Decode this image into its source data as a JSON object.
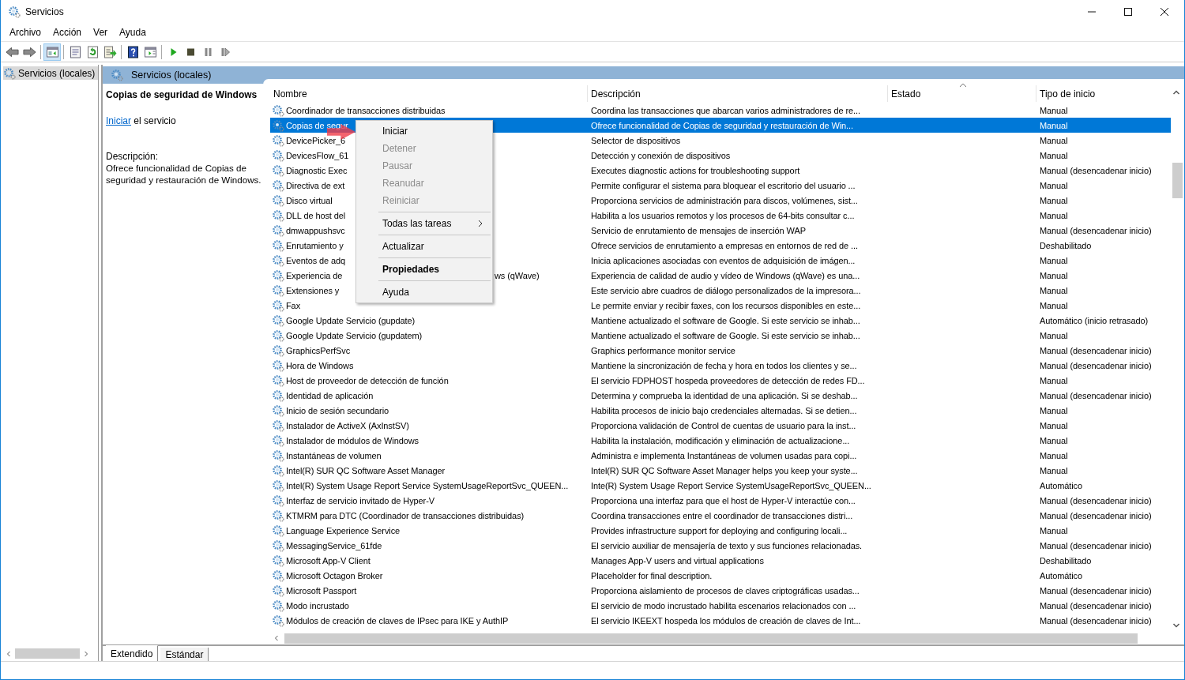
{
  "window": {
    "title": "Servicios"
  },
  "menu": [
    "Archivo",
    "Acción",
    "Ver",
    "Ayuda"
  ],
  "toolbar_groups": [
    {
      "buttons": [
        {
          "kind": "back",
          "pressed": false
        },
        {
          "kind": "forward",
          "pressed": false
        }
      ]
    },
    {
      "buttons": [
        {
          "kind": "console-tree",
          "pressed": true
        }
      ]
    },
    {
      "buttons": [
        {
          "kind": "properties",
          "pressed": false
        },
        {
          "kind": "refresh",
          "pressed": false
        },
        {
          "kind": "export",
          "pressed": false
        }
      ]
    },
    {
      "buttons": [
        {
          "kind": "help",
          "pressed": false
        },
        {
          "kind": "view",
          "pressed": false
        }
      ]
    },
    {
      "buttons": [
        {
          "kind": "play",
          "pressed": false
        },
        {
          "kind": "stop",
          "pressed": false
        },
        {
          "kind": "pause",
          "pressed": false
        },
        {
          "kind": "resume",
          "pressed": false
        }
      ]
    }
  ],
  "tree": [
    {
      "label": "Servicios (locales)",
      "selected": true
    }
  ],
  "pane_title": "Servicios (locales)",
  "detail": {
    "title": "Copias de seguridad de Windows",
    "action_link": "Iniciar",
    "action_rest": " el servicio",
    "description_label": "Descripción:",
    "description": "Ofrece funcionalidad de Copias de seguridad y restauración de Windows."
  },
  "table": {
    "columns": [
      {
        "label": "Nombre",
        "sorted": false
      },
      {
        "label": "Descripción",
        "sorted": false
      },
      {
        "label": "Estado",
        "sorted": true
      },
      {
        "label": "Tipo de inicio",
        "sorted": false
      }
    ],
    "rows": [
      {
        "name": "Coordinador de transacciones distribuidas",
        "description": "Coordina las transacciones que abarcan varios administradores de re...",
        "startup": "Manual",
        "selected": false
      },
      {
        "name": "Copias de segur",
        "description": "Ofrece funcionalidad de Copias de seguridad y restauración de Win...",
        "startup": "Manual",
        "selected": true
      },
      {
        "name": "DevicePicker_6",
        "description": "Selector de dispositivos",
        "startup": "Manual",
        "selected": false
      },
      {
        "name": "DevicesFlow_61",
        "description": "Detección y conexión de dispositivos",
        "startup": "Manual",
        "selected": false
      },
      {
        "name": "Diagnostic Exec",
        "description": "Executes diagnostic actions for troubleshooting support",
        "startup": "Manual (desencadenar inicio)",
        "selected": false
      },
      {
        "name": "Directiva de ext",
        "description": "Permite configurar el sistema para bloquear el escritorio del usuario ...",
        "startup": "Manual",
        "selected": false
      },
      {
        "name": "Disco virtual",
        "description": "Proporciona servicios de administración para discos, volúmenes, sist...",
        "startup": "Manual",
        "selected": false
      },
      {
        "name": "DLL de host del",
        "description": "Habilita a los usuarios remotos y los procesos de 64-bits consultar c...",
        "startup": "Manual",
        "selected": false
      },
      {
        "name": "dmwappushsvc",
        "description": "Servicio de enrutamiento de mensajes de inserción WAP",
        "startup": "Manual (desencadenar inicio)",
        "selected": false
      },
      {
        "name": "Enrutamiento y",
        "description": "Ofrece servicios de enrutamiento a empresas en entornos de red de ...",
        "startup": "Deshabilitado",
        "selected": false
      },
      {
        "name": "Eventos de adq",
        "description": "Inicia aplicaciones asociadas con eventos de adquisición de imágen...",
        "startup": "Manual",
        "selected": false
      },
      {
        "name": "Experiencia de",
        "name_tail": "ws (qWave)",
        "description": "Experiencia de calidad de audio y vídeo de Windows (qWave) es una...",
        "startup": "Manual",
        "selected": false
      },
      {
        "name": "Extensiones y",
        "description": "Este servicio abre cuadros de diálogo personalizados de la impresora...",
        "startup": "Manual",
        "selected": false
      },
      {
        "name": "Fax",
        "description": "Le permite enviar y recibir faxes, con los recursos disponibles en este...",
        "startup": "Manual",
        "selected": false
      },
      {
        "name": "Google Update Servicio (gupdate)",
        "description": "Mantiene actualizado el software de Google. Si este servicio se inhab...",
        "startup": "Automático (inicio retrasado)",
        "selected": false
      },
      {
        "name": "Google Update Servicio (gupdatem)",
        "description": "Mantiene actualizado el software de Google. Si este servicio se inhab...",
        "startup": "Manual",
        "selected": false
      },
      {
        "name": "GraphicsPerfSvc",
        "description": "Graphics performance monitor service",
        "startup": "Manual (desencadenar inicio)",
        "selected": false
      },
      {
        "name": "Hora de Windows",
        "description": "Mantiene la sincronización de fecha y hora en todos los clientes y se...",
        "startup": "Manual (desencadenar inicio)",
        "selected": false
      },
      {
        "name": "Host de proveedor de detección de función",
        "description": "El servicio FDPHOST hospeda proveedores de detección de redes FD...",
        "startup": "Manual",
        "selected": false
      },
      {
        "name": "Identidad de aplicación",
        "description": "Determina y comprueba la identidad de una aplicación. Si se deshab...",
        "startup": "Manual (desencadenar inicio)",
        "selected": false
      },
      {
        "name": "Inicio de sesión secundario",
        "description": "Habilita procesos de inicio bajo credenciales alternadas. Si se detien...",
        "startup": "Manual",
        "selected": false
      },
      {
        "name": "Instalador de ActiveX (AxInstSV)",
        "description": "Proporciona validación de Control de cuentas de usuario para la inst...",
        "startup": "Manual",
        "selected": false
      },
      {
        "name": "Instalador de módulos de Windows",
        "description": "Habilita la instalación, modificación y eliminación de actualizacione...",
        "startup": "Manual",
        "selected": false
      },
      {
        "name": "Instantáneas de volumen",
        "description": "Administra e implementa Instantáneas de volumen usadas para copi...",
        "startup": "Manual",
        "selected": false
      },
      {
        "name": "Intel(R) SUR QC Software Asset Manager",
        "description": "Intel(R) SUR QC Software Asset Manager helps you keep your syste...",
        "startup": "Manual",
        "selected": false
      },
      {
        "name": "Intel(R) System Usage Report Service SystemUsageReportSvc_QUEEN...",
        "description": "Inte(R) System Usage Report Service SystemUsageReportSvc_QUEEN...",
        "startup": "Automático",
        "selected": false
      },
      {
        "name": "Interfaz de servicio invitado de Hyper-V",
        "description": "Proporciona una interfaz para que el host de Hyper-V interactúe con...",
        "startup": "Manual (desencadenar inicio)",
        "selected": false
      },
      {
        "name": "KTMRM para DTC (Coordinador de transacciones distribuidas)",
        "description": "Coordina transacciones entre el coordinador de transacciones distri...",
        "startup": "Manual (desencadenar inicio)",
        "selected": false
      },
      {
        "name": "Language Experience Service",
        "description": "Provides infrastructure support for deploying and configuring locali...",
        "startup": "Manual",
        "selected": false
      },
      {
        "name": "MessagingService_61fde",
        "description": "El servicio auxiliar de mensajería de texto y sus funciones relacionadas.",
        "startup": "Manual (desencadenar inicio)",
        "selected": false
      },
      {
        "name": "Microsoft App-V Client",
        "description": "Manages App-V users and virtual applications",
        "startup": "Deshabilitado",
        "selected": false
      },
      {
        "name": "Microsoft Octagon Broker",
        "description": "Placeholder for final description.",
        "startup": "Automático",
        "selected": false
      },
      {
        "name": "Microsoft Passport",
        "description": "Proporciona aislamiento de procesos de claves criptográficas usadas...",
        "startup": "Manual (desencadenar inicio)",
        "selected": false
      },
      {
        "name": "Modo incrustado",
        "description": "El servicio de modo incrustado habilita escenarios relacionados con ...",
        "startup": "Manual (desencadenar inicio)",
        "selected": false
      },
      {
        "name": "Módulos de creación de claves de IPsec para IKE y AuthIP",
        "description": "El servicio IKEEXT hospeda los módulos de creación de claves de Int...",
        "startup": "Manual (desencadenar inicio)",
        "selected": false
      }
    ]
  },
  "context_menu": [
    {
      "label": "Iniciar",
      "disabled": false,
      "default": false,
      "submenu": false,
      "separator_before": false
    },
    {
      "label": "Detener",
      "disabled": true,
      "default": false,
      "submenu": false,
      "separator_before": false
    },
    {
      "label": "Pausar",
      "disabled": true,
      "default": false,
      "submenu": false,
      "separator_before": false
    },
    {
      "label": "Reanudar",
      "disabled": true,
      "default": false,
      "submenu": false,
      "separator_before": false
    },
    {
      "label": "Reiniciar",
      "disabled": true,
      "default": false,
      "submenu": false,
      "separator_before": false
    },
    {
      "label": "Todas las tareas",
      "disabled": false,
      "default": false,
      "submenu": true,
      "separator_before": true
    },
    {
      "label": "Actualizar",
      "disabled": false,
      "default": false,
      "submenu": false,
      "separator_before": true
    },
    {
      "label": "Propiedades",
      "disabled": false,
      "default": true,
      "submenu": false,
      "separator_before": true
    },
    {
      "label": "Ayuda",
      "disabled": false,
      "default": false,
      "submenu": false,
      "separator_before": true
    }
  ],
  "view_tabs": [
    {
      "label": "Extendido",
      "selected": true
    },
    {
      "label": "Estándar",
      "selected": false
    }
  ]
}
